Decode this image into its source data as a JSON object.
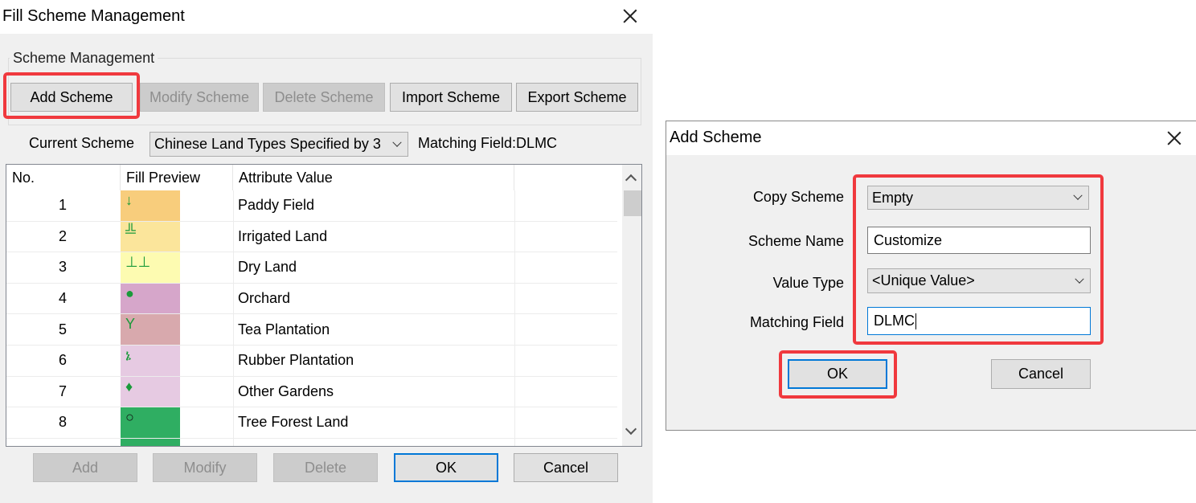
{
  "main_dialog": {
    "title": "Fill Scheme Management",
    "group_label": "Scheme Management",
    "buttons": {
      "add_scheme": "Add Scheme",
      "modify_scheme": "Modify Scheme",
      "delete_scheme": "Delete Scheme",
      "import_scheme": "Import Scheme",
      "export_scheme": "Export Scheme"
    },
    "current_scheme_label": "Current Scheme",
    "current_scheme_value": "Chinese Land Types Specified by 3",
    "matching_field_text": "Matching Field:DLMC",
    "table": {
      "columns": [
        "No.",
        "Fill Preview",
        "Attribute Value"
      ],
      "rows": [
        {
          "no": "1",
          "symbol": "↓",
          "color": "#f8cd7c",
          "attr": "Paddy Field"
        },
        {
          "no": "2",
          "symbol": "╩",
          "color": "#fbe59b",
          "attr": "Irrigated Land"
        },
        {
          "no": "3",
          "symbol": "⊥⊥",
          "color": "#fdfbb1",
          "attr": "Dry Land"
        },
        {
          "no": "4",
          "symbol": "●",
          "color": "#d6a6ca",
          "attr": "Orchard"
        },
        {
          "no": "5",
          "symbol": "Y",
          "color": "#d8a9ad",
          "attr": "Tea Plantation"
        },
        {
          "no": "6",
          "symbol": "ኔ",
          "color": "#e6cae2",
          "attr": "Rubber Plantation"
        },
        {
          "no": "7",
          "symbol": "♦",
          "color": "#e6cae2",
          "attr": "Other Gardens"
        },
        {
          "no": "8",
          "symbol": "○",
          "color": "#2fae62",
          "attr": "Tree Forest Land"
        }
      ]
    },
    "bottom_buttons": {
      "add": "Add",
      "modify": "Modify",
      "delete": "Delete",
      "ok": "OK",
      "cancel": "Cancel"
    }
  },
  "add_dialog": {
    "title": "Add Scheme",
    "fields": {
      "copy_scheme_label": "Copy Scheme",
      "copy_scheme_value": "Empty",
      "scheme_name_label": "Scheme Name",
      "scheme_name_value": "Customize",
      "value_type_label": "Value Type",
      "value_type_value": "<Unique Value>",
      "matching_field_label": "Matching Field",
      "matching_field_value": "DLMC"
    },
    "buttons": {
      "ok": "OK",
      "cancel": "Cancel"
    }
  },
  "colors": {
    "highlight": "#f0393e",
    "focus_accent": "#0078d7",
    "dialog_bg": "#f0f0f0"
  }
}
